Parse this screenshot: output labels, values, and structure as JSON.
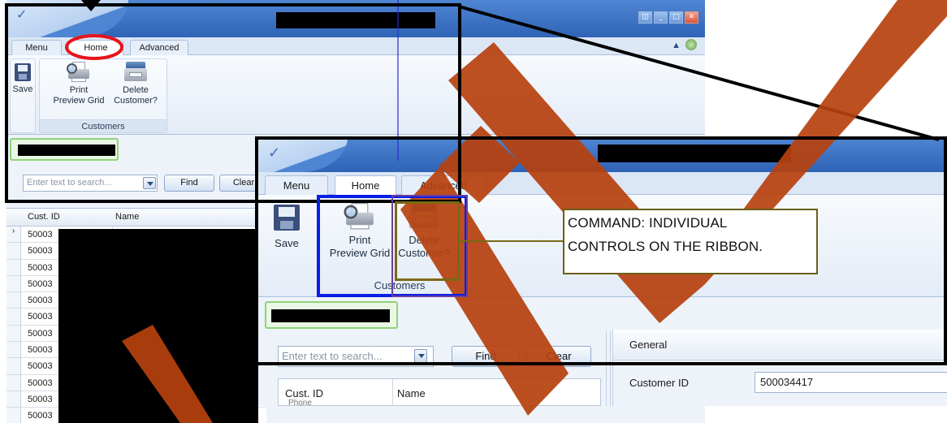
{
  "back_window": {
    "ribbon_tabs": [
      "Menu",
      "Home",
      "Advanced"
    ],
    "ribbon_group_label": "Customers",
    "commands": {
      "save": "Save",
      "print_preview_line1": "Print",
      "print_preview_line2": "Preview Grid",
      "delete_line1": "Delete",
      "delete_line2": "Customer?"
    },
    "search": {
      "placeholder": "Enter text to search...",
      "find_label": "Find",
      "clear_label": "Clear"
    },
    "grid": {
      "columns": [
        "Cust. ID",
        "Name"
      ],
      "row_prefixes": [
        "50003",
        "50003",
        "50003",
        "50003",
        "50003",
        "50003",
        "50003",
        "50003",
        "50003",
        "50003",
        "50003",
        "50003"
      ]
    }
  },
  "zoom_window": {
    "ribbon_tabs": [
      "Menu",
      "Home",
      "Advanced"
    ],
    "ribbon_group_label": "Customers",
    "commands": {
      "save": "Save",
      "print_preview_line1": "Print",
      "print_preview_line2": "Preview Grid",
      "delete_line1": "Delete",
      "delete_line2": "Customer?"
    },
    "search": {
      "placeholder": "Enter text to search...",
      "find_label": "Find",
      "clear_label": "Clear"
    },
    "grid": {
      "columns": [
        "Cust. ID",
        "Name"
      ],
      "sub_header": "Phone"
    },
    "general_panel": {
      "title": "General",
      "customer_id_label": "Customer ID",
      "customer_id_value": "500034417"
    }
  },
  "callout": {
    "line1": "COMMAND: INDIVIDUAL",
    "line2": "CONTROLS ON THE RIBBON."
  },
  "colors": {
    "highlight_circle": "#e8141b",
    "group_highlight": "#0a1ee6",
    "command_highlight": "#7a6a12",
    "watermark": "#b7410e",
    "frame": "#000000"
  }
}
